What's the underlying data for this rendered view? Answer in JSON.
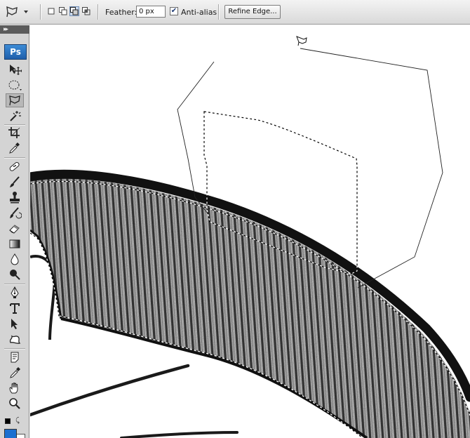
{
  "options_bar": {
    "feather_label": "Feather:",
    "feather_value": "0 px",
    "anti_alias_label": "Anti-alias",
    "anti_alias_checked": true,
    "refine_edge_label": "Refine Edge...",
    "selection_modes": [
      "new-selection-icon",
      "add-to-selection-icon",
      "subtract-from-selection-icon",
      "intersect-selection-icon"
    ],
    "active_selection_mode": "subtract-from-selection-icon"
  },
  "tools_panel": {
    "logo_text": "Ps",
    "selected_tool": "polygonal-lasso-tool",
    "foreground_color": "#1c6fd0",
    "background_color": "#ffffff",
    "tools": [
      "move-tool",
      "marquee-tool",
      "polygonal-lasso-tool",
      "magic-wand-tool",
      "crop-tool",
      "eyedropper-tool",
      "healing-brush-tool",
      "brush-tool",
      "clone-stamp-tool",
      "history-brush-tool",
      "eraser-tool",
      "gradient-tool",
      "blur-tool",
      "dodge-tool",
      "pen-tool",
      "type-tool",
      "path-selection-tool",
      "custom-shape-tool",
      "notes-tool",
      "eyedropper-3d-tool",
      "hand-tool",
      "zoom-tool"
    ]
  },
  "canvas": {
    "image_subject": "hatched-band",
    "colors": {
      "ink": "#111111",
      "band_fill": "#b3b3b3",
      "marching_ants": "#000000"
    }
  }
}
